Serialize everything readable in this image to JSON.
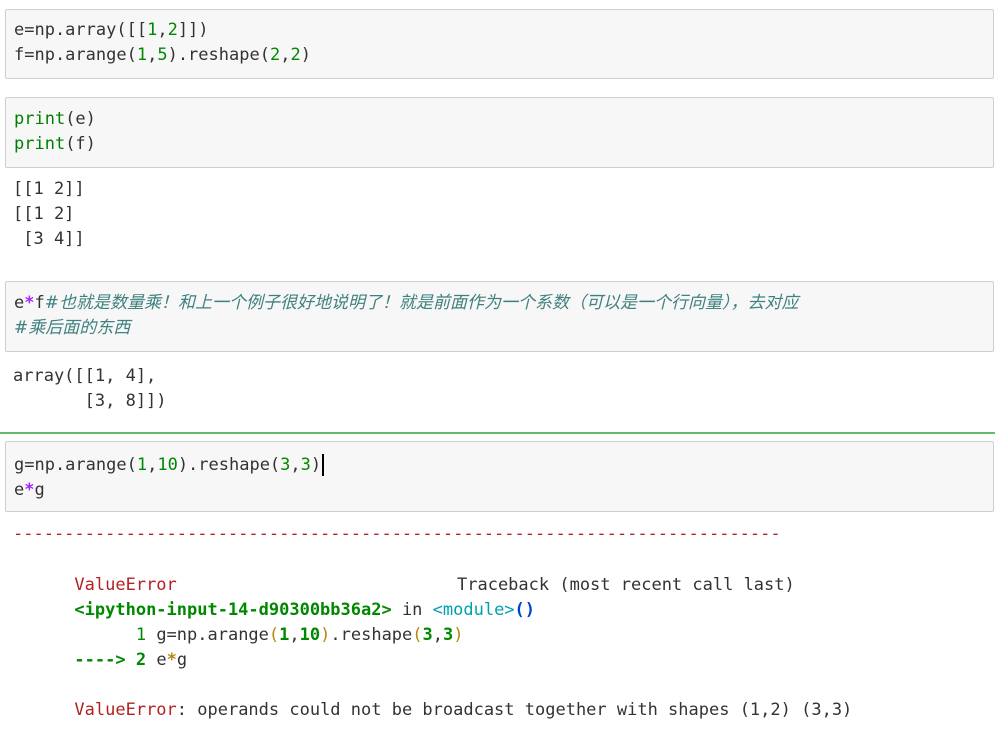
{
  "cells": {
    "c1": {
      "lines": [
        [
          {
            "t": "e=np.array([[",
            "c": "plain"
          },
          {
            "t": "1",
            "c": "num"
          },
          {
            "t": ",",
            "c": "plain"
          },
          {
            "t": "2",
            "c": "num"
          },
          {
            "t": "]])",
            "c": "plain"
          }
        ],
        [
          {
            "t": "f=np.arange(",
            "c": "plain"
          },
          {
            "t": "1",
            "c": "num"
          },
          {
            "t": ",",
            "c": "plain"
          },
          {
            "t": "5",
            "c": "num"
          },
          {
            "t": ").reshape(",
            "c": "plain"
          },
          {
            "t": "2",
            "c": "num"
          },
          {
            "t": ",",
            "c": "plain"
          },
          {
            "t": "2",
            "c": "num"
          },
          {
            "t": ")",
            "c": "plain"
          }
        ]
      ]
    },
    "c2": {
      "lines": [
        [
          {
            "t": "print",
            "c": "kw"
          },
          {
            "t": "(e)",
            "c": "plain"
          }
        ],
        [
          {
            "t": "print",
            "c": "kw"
          },
          {
            "t": "(f)",
            "c": "plain"
          }
        ]
      ],
      "output": [
        "[[1 2]]",
        "[[1 2]",
        " [3 4]]"
      ]
    },
    "c3": {
      "lines": [
        [
          {
            "t": "e",
            "c": "plain"
          },
          {
            "t": "*",
            "c": "op"
          },
          {
            "t": "f",
            "c": "plain"
          },
          {
            "t": "#也就是数量乘！和上一个例子很好地说明了！就是前面作为一个系数（可以是一个行向量），去对应",
            "c": "comment"
          }
        ],
        [
          {
            "t": "#乘后面的东西",
            "c": "comment"
          }
        ]
      ],
      "output": [
        "array([[1, 4],",
        "       [3, 8]])"
      ]
    },
    "c4": {
      "lines": [
        [
          {
            "t": "g=np.arange(",
            "c": "plain"
          },
          {
            "t": "1",
            "c": "num"
          },
          {
            "t": ",",
            "c": "plain"
          },
          {
            "t": "10",
            "c": "num"
          },
          {
            "t": ").reshape(",
            "c": "plain"
          },
          {
            "t": "3",
            "c": "num"
          },
          {
            "t": ",",
            "c": "plain"
          },
          {
            "t": "3",
            "c": "num"
          },
          {
            "t": ")",
            "c": "plain"
          }
        ],
        [
          {
            "t": "e",
            "c": "plain"
          },
          {
            "t": "*",
            "c": "op"
          },
          {
            "t": "g",
            "c": "plain"
          }
        ]
      ]
    }
  },
  "traceback": {
    "separator": "---------------------------------------------------------------------------",
    "error_name": "ValueError",
    "header_right": "Traceback (most recent call last)",
    "location_file": "<ipython-input-14-d90300bb36a2>",
    "location_in": " in ",
    "location_module": "<module>",
    "location_call": "()",
    "line1_num": "      1 ",
    "line1_code_a": "g=np.arange",
    "line1_p1": "(",
    "line1_n1": "1",
    "line1_c": ",",
    "line1_n2": "10",
    "line1_p2": ")",
    "line1_code_b": ".reshape",
    "line1_p3": "(",
    "line1_n3": "3",
    "line1_c2": ",",
    "line1_n4": "3",
    "line1_p4": ")",
    "line2_arrow": "----> 2 ",
    "line2_a": "e",
    "line2_op": "*",
    "line2_b": "g",
    "final_error_name": "ValueError",
    "final_error_msg": ": operands could not be broadcast together with shapes (1,2) (3,3)"
  }
}
